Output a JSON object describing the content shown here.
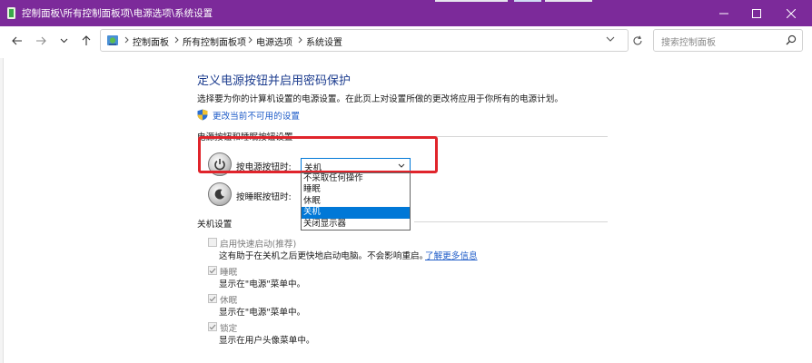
{
  "window": {
    "title": "控制面板\\所有控制面板项\\电源选项\\系统设置",
    "accent": "#7c2a9a"
  },
  "nav": {
    "back_icon": "arrow-left-icon",
    "forward_icon": "arrow-right-icon",
    "recent_icon": "chevron-down-icon",
    "up_icon": "arrow-up-icon"
  },
  "address": {
    "crumbs": [
      "控制面板",
      "所有控制面板项",
      "电源选项",
      "系统设置"
    ]
  },
  "search": {
    "placeholder": "搜索控制面板"
  },
  "content": {
    "heading": "定义电源按钮并启用密码保护",
    "description": "选择要为你的计算机设置的电源设置。在此页上对设置所做的更改将应用于你所有的电源计划。",
    "change_link": "更改当前不可用的设置",
    "buttons_section": "电源按钮和睡眠按钮设置",
    "power_button_label": "按电源按钮时:",
    "power_button_value": "关机",
    "sleep_button_label": "按睡眠按钮时:",
    "dropdown_options": [
      "不采取任何操作",
      "睡眠",
      "休眠",
      "关机",
      "关闭显示器"
    ],
    "selected_index": 3,
    "shutdown_section": "关机设置",
    "settings": [
      {
        "label": "启用快速启动(推荐)",
        "sub": "这有助于在关机之后更快地启动电脑。不会影响重启。",
        "link": "了解更多信息",
        "checked": false
      },
      {
        "label": "睡眠",
        "sub": "显示在\"电源\"菜单中。",
        "checked": true
      },
      {
        "label": "休眠",
        "sub": "显示在\"电源\"菜单中。",
        "checked": true
      },
      {
        "label": "锁定",
        "sub": "显示在用户头像菜单中。",
        "checked": true
      }
    ]
  },
  "colors": {
    "heading": "#1d3d8f",
    "link": "#1f5cc8",
    "highlight": "#e0242b",
    "selection": "#0078d7"
  }
}
